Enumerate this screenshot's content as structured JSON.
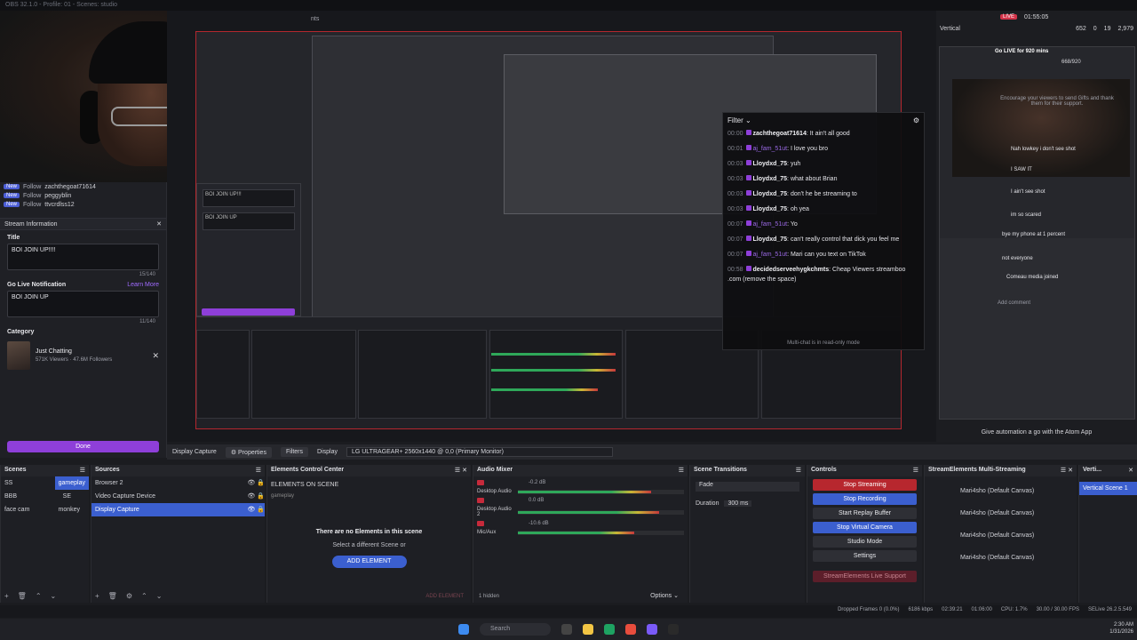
{
  "titlebar": {
    "text": "OBS 32.1.0 - Profile: 01 - Scenes: studio",
    "fragment": "nts"
  },
  "feed": [
    {
      "badge": "New",
      "type": "Follow",
      "user": "zachthegoat71614"
    },
    {
      "badge": "New",
      "type": "Follow",
      "user": "peggyblin"
    },
    {
      "badge": "New",
      "type": "Follow",
      "user": "ttvcrdlss12"
    }
  ],
  "stream_info": {
    "title": "Stream Information",
    "title_label": "Title",
    "title_value": "BOI JOIN UP!!!!",
    "title_count": "15/140",
    "notif_label": "Go Live Notification",
    "learn_more": "Learn More",
    "notif_value": "BOI JOIN UP",
    "notif_count": "11/140",
    "category_label": "Category",
    "category_name": "Just Chatting",
    "category_stats": "571K Viewers · 47.6M Followers",
    "done": "Done"
  },
  "chat": {
    "filter": "Filter",
    "messages": [
      {
        "time": "00:00",
        "user": "zachthegoat71614",
        "text": "It ain't all good"
      },
      {
        "time": "00:01",
        "user": "aj_fam_51ut",
        "text": "I love you bro"
      },
      {
        "time": "00:03",
        "user": "Lloydxd_75",
        "text": "yuh"
      },
      {
        "time": "00:03",
        "user": "Lloydxd_75",
        "text": "what about Brian"
      },
      {
        "time": "00:03",
        "user": "Lloydxd_75",
        "text": "don't he be streaming to"
      },
      {
        "time": "00:03",
        "user": "Lloydxd_75",
        "text": "oh yea"
      },
      {
        "time": "00:07",
        "user": "aj_fam_51ut",
        "text": "Yo"
      },
      {
        "time": "00:07",
        "user": "Lloydxd_75",
        "text": "can't really control that dick you feel me"
      },
      {
        "time": "00:07",
        "user": "aj_fam_51ut",
        "text": "Mari can you text on TikTok"
      },
      {
        "time": "00:58",
        "user": "decidedserveehygkchmts",
        "text": "Cheap Viewers streamboo .com (remove the space)"
      }
    ],
    "footer": "Multi-chat is in read-only mode"
  },
  "vertical": {
    "label": "Vertical",
    "live": "LIVE",
    "timer": "01:55:05",
    "viewers": "652",
    "stat2": "0",
    "stat3": "19",
    "likes": "2,979",
    "golive": "Go LIVE for 920 mins",
    "progress": "668/920",
    "encourage": "Encourage your viewers to send Gifts and thank them for their support.",
    "msgs": [
      "Nah lowkey i don't see shot",
      "I SAW IT",
      "I ain't see shot",
      "im so scared",
      "bye my phone at 1 percent",
      "not everyone",
      "Comeau media joined"
    ],
    "add_comment": "Add comment",
    "automation": "Give automation a go with the Atom App"
  },
  "context": {
    "properties": "Properties",
    "filters": "Filters",
    "display_label": "Display",
    "display_value": "LG ULTRAGEAR+ 2560x1440 @ 0,0 (Primary Monitor)",
    "source": "Display Capture"
  },
  "scenes": {
    "title": "Scenes",
    "items": [
      [
        "SS",
        "gameplay"
      ],
      [
        "BBB",
        "SE"
      ],
      [
        "face cam",
        "monkey"
      ]
    ]
  },
  "sources": {
    "title": "Sources",
    "items": [
      "Browser 2",
      "Video Capture Device",
      "Display Capture"
    ]
  },
  "elements": {
    "title": "Elements Control Center",
    "heading": "ELEMENTS ON SCENE",
    "scene": "gameplay",
    "empty": "There are no Elements in this scene",
    "select": "Select a different Scene or",
    "add": "ADD ELEMENT",
    "foot": "ADD ELEMENT"
  },
  "mixer": {
    "title": "Audio Mixer",
    "tracks": [
      {
        "name": "Desktop Audio",
        "db": "-0.2 dB"
      },
      {
        "name": "Desktop Audio 2",
        "db": "0.0 dB"
      },
      {
        "name": "Mic/Aux",
        "db": "-10.6 dB"
      }
    ],
    "hidden": "1 hidden"
  },
  "transitions": {
    "title": "Scene Transitions",
    "type": "Fade",
    "duration_label": "Duration",
    "duration": "300 ms"
  },
  "controls": {
    "title": "Controls",
    "buttons": [
      "Stop Streaming",
      "Stop Recording",
      "Start Replay Buffer",
      "Stop Virtual Camera",
      "Studio Mode",
      "Settings",
      "StreamElements Live Support"
    ]
  },
  "multistream": {
    "title": "StreamElements Multi-Streaming",
    "rows": [
      "Mari4sho (Default Canvas)",
      "Mari4sho (Default Canvas)",
      "Mari4sho (Default Canvas)",
      "Mari4sho (Default Canvas)"
    ]
  },
  "verticalscenes": {
    "title": "Vertical Scenes",
    "item": "Vertical Scene 1"
  },
  "status": {
    "dropped": "Dropped Frames 0 (0.0%)",
    "kbps": "6186 kbps",
    "rec": "02:39:21",
    "live": "01:06:00",
    "cpu": "CPU: 1.7%",
    "fps": "30.00 / 30.00 FPS",
    "extra": "SELive 26.2.5.549"
  },
  "taskbar": {
    "search": "Search",
    "time": "2:30 AM",
    "date": "1/31/2026"
  }
}
